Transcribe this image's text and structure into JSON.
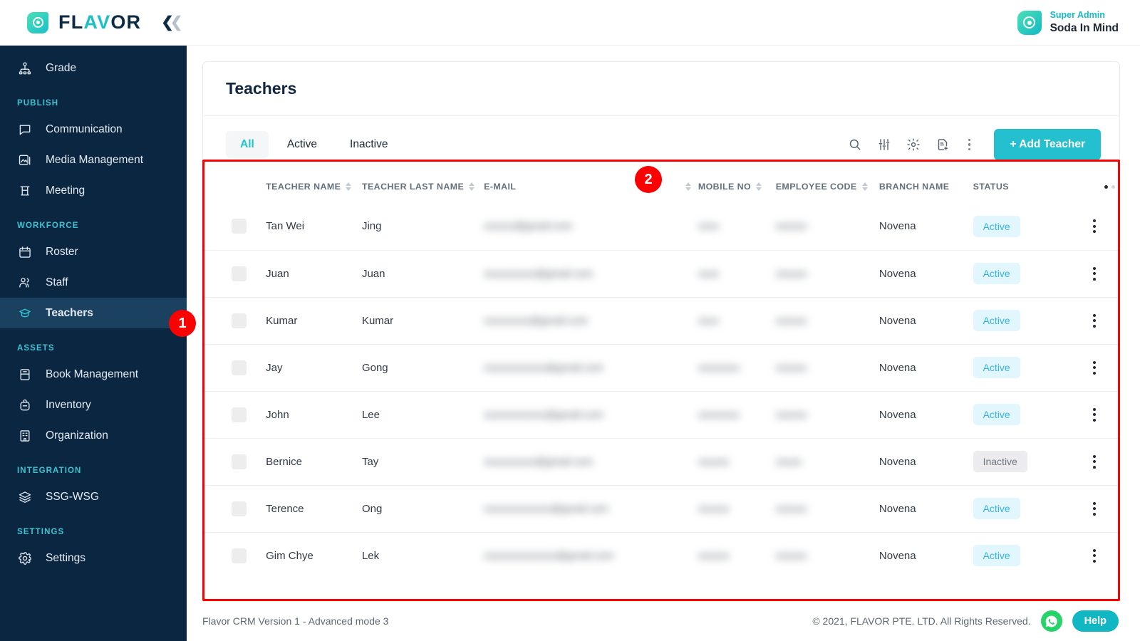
{
  "brand": {
    "name_dark_1": "FL",
    "name_teal": "A",
    "name_dark_2": "V",
    "name_teal_2": "",
    "full": "FLAVOR",
    "collapse_icon": "chevron-double-left"
  },
  "user": {
    "role": "Super Admin",
    "name": "Soda In Mind"
  },
  "sidebar": {
    "items": [
      {
        "label": "Grade",
        "icon": "grade-icon",
        "active": false,
        "section": null
      },
      {
        "label": "PUBLISH",
        "type": "section"
      },
      {
        "label": "Communication",
        "icon": "chat-icon",
        "active": false
      },
      {
        "label": "Media Management",
        "icon": "image-icon",
        "active": false
      },
      {
        "label": "Meeting",
        "icon": "podium-icon",
        "active": false
      },
      {
        "label": "WORKFORCE",
        "type": "section"
      },
      {
        "label": "Roster",
        "icon": "calendar-icon",
        "active": false
      },
      {
        "label": "Staff",
        "icon": "people-icon",
        "active": false
      },
      {
        "label": "Teachers",
        "icon": "graduation-cap-icon",
        "active": true
      },
      {
        "label": "ASSETS",
        "type": "section"
      },
      {
        "label": "Book Management",
        "icon": "book-icon",
        "active": false
      },
      {
        "label": "Inventory",
        "icon": "backpack-icon",
        "active": false
      },
      {
        "label": "Organization",
        "icon": "building-icon",
        "active": false
      },
      {
        "label": "INTEGRATION",
        "type": "section"
      },
      {
        "label": "SSG-WSG",
        "icon": "layers-icon",
        "active": false
      },
      {
        "label": "SETTINGS",
        "type": "section"
      },
      {
        "label": "Settings",
        "icon": "gear-icon",
        "active": false
      }
    ]
  },
  "page": {
    "title": "Teachers"
  },
  "tabs": [
    {
      "label": "All",
      "active": true
    },
    {
      "label": "Active",
      "active": false
    },
    {
      "label": "Inactive",
      "active": false
    }
  ],
  "toolbar": {
    "icons": [
      "search-icon",
      "filter-sliders-icon",
      "gear-icon",
      "document-add-icon",
      "kebab-menu-icon"
    ],
    "add_label": "+ Add Teacher"
  },
  "table": {
    "columns": [
      {
        "label": "",
        "sortable": false,
        "key": "checkbox"
      },
      {
        "label": "TEACHER NAME",
        "sortable": true
      },
      {
        "label": "TEACHER LAST NAME",
        "sortable": true
      },
      {
        "label": "E-MAIL",
        "sortable": true
      },
      {
        "label": "MOBILE NO",
        "sortable": true
      },
      {
        "label": "EMPLOYEE CODE",
        "sortable": true
      },
      {
        "label": "BRANCH NAME",
        "sortable": false
      },
      {
        "label": "STATUS",
        "sortable": false
      },
      {
        "label": "",
        "sortable": false,
        "key": "actions"
      }
    ],
    "rows": [
      {
        "first": "Tan Wei",
        "last": "Jing",
        "email": "xxxxxx@gmail.com",
        "mobile": "xxxx",
        "code": "xxxxxx",
        "branch": "Novena",
        "status": "Active"
      },
      {
        "first": "Juan",
        "last": "Juan",
        "email": "xxxxxxxxxx@gmail.com",
        "mobile": "xxxx",
        "code": "xxxxxx",
        "branch": "Novena",
        "status": "Active"
      },
      {
        "first": "Kumar",
        "last": "Kumar",
        "email": "xxxxxxxxx@gmail.com",
        "mobile": "xxxx",
        "code": "xxxxxx",
        "branch": "Novena",
        "status": "Active"
      },
      {
        "first": "Jay",
        "last": "Gong",
        "email": "xxxxxxxxxxxx@gmail.com",
        "mobile": "xxxxxxxx",
        "code": "xxxxxx",
        "branch": "Novena",
        "status": "Active"
      },
      {
        "first": "John",
        "last": "Lee",
        "email": "xxxxxxxxxxxx@gmail.com",
        "mobile": "xxxxxxxx",
        "code": "xxxxxx",
        "branch": "Novena",
        "status": "Active"
      },
      {
        "first": "Bernice",
        "last": "Tay",
        "email": "xxxxxxxxxx@gmail.com",
        "mobile": "xxxxxx",
        "code": "xxxxx",
        "branch": "Novena",
        "status": "Inactive"
      },
      {
        "first": "Terence",
        "last": "Ong",
        "email": "xxxxxxxxxxxxx@gmail.com",
        "mobile": "xxxxxx",
        "code": "xxxxxx",
        "branch": "Novena",
        "status": "Active"
      },
      {
        "first": "Gim Chye",
        "last": "Lek",
        "email": "xxxxxxxxxxxxxx@gmail.com",
        "mobile": "xxxxxx",
        "code": "xxxxxx",
        "branch": "Novena",
        "status": "Active"
      }
    ]
  },
  "footer": {
    "version": "Flavor CRM Version 1 - Advanced mode 3",
    "copyright": "© 2021, FLAVOR PTE. LTD. All Rights Reserved.",
    "help_label": "Help",
    "whatsapp_icon": "whatsapp-icon"
  },
  "annotations": [
    {
      "number": "1",
      "target": "sidebar-item-teachers"
    },
    {
      "number": "2",
      "target": "teachers-table"
    }
  ],
  "colors": {
    "accent_teal": "#25c0cf",
    "sidebar_bg": "#0b2641",
    "sidebar_active_bg": "#1b4161",
    "section_label": "#3fc3d2",
    "badge_active_bg": "#e2f6fd",
    "badge_active_text": "#34b3e4",
    "badge_inactive_bg": "#ececee",
    "badge_inactive_text": "#6c7580",
    "annotation_red": "#fb0101",
    "whatsapp_green": "#25d366"
  }
}
